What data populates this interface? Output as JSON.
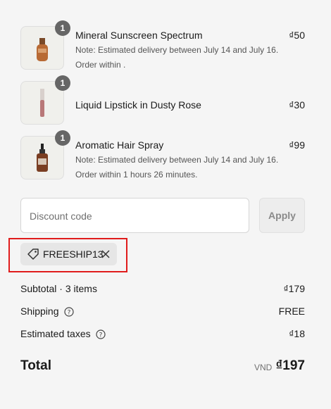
{
  "items": [
    {
      "name": "Mineral Sunscreen Spectrum",
      "price": "₫50",
      "qty": "1",
      "note_lines": [
        "Note: Estimated delivery between July 14 and July 16.",
        "Order within ."
      ]
    },
    {
      "name": "Liquid Lipstick in Dusty Rose",
      "price": "₫30",
      "qty": "1",
      "note_lines": []
    },
    {
      "name": "Aromatic Hair Spray",
      "price": "₫99",
      "qty": "1",
      "note_lines": [
        "Note: Estimated delivery between July 14 and July 16.",
        "Order within 1 hours 26 minutes."
      ]
    }
  ],
  "discount": {
    "placeholder": "Discount code",
    "apply_label": "Apply",
    "applied_code": "FREESHIP13"
  },
  "summary": {
    "subtotal_label": "Subtotal · 3 items",
    "subtotal_value": "₫179",
    "shipping_label": "Shipping",
    "shipping_value": "FREE",
    "taxes_label": "Estimated taxes",
    "taxes_value": "₫18",
    "total_label": "Total",
    "total_currency": "VND",
    "total_value": "₫197"
  },
  "colors": {
    "highlight": "#e01c1c",
    "qty_badge": "#666666",
    "background": "#f5f5f5"
  }
}
